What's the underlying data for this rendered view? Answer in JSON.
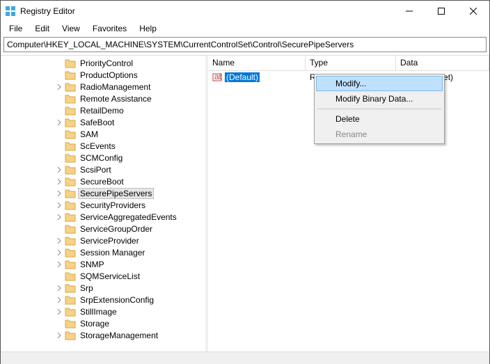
{
  "window": {
    "title": "Registry Editor"
  },
  "menubar": {
    "items": [
      "File",
      "Edit",
      "View",
      "Favorites",
      "Help"
    ]
  },
  "address": {
    "path": "Computer\\HKEY_LOCAL_MACHINE\\SYSTEM\\CurrentControlSet\\Control\\SecurePipeServers"
  },
  "tree": {
    "indent": 78,
    "selected": "SecurePipeServers",
    "items": [
      {
        "label": "PriorityControl",
        "expander": false
      },
      {
        "label": "ProductOptions",
        "expander": false
      },
      {
        "label": "RadioManagement",
        "expander": true
      },
      {
        "label": "Remote Assistance",
        "expander": false
      },
      {
        "label": "RetailDemo",
        "expander": false
      },
      {
        "label": "SafeBoot",
        "expander": true
      },
      {
        "label": "SAM",
        "expander": false
      },
      {
        "label": "ScEvents",
        "expander": false
      },
      {
        "label": "SCMConfig",
        "expander": false
      },
      {
        "label": "ScsiPort",
        "expander": true
      },
      {
        "label": "SecureBoot",
        "expander": true
      },
      {
        "label": "SecurePipeServers",
        "expander": true,
        "selected": true
      },
      {
        "label": "SecurityProviders",
        "expander": true
      },
      {
        "label": "ServiceAggregatedEvents",
        "expander": true
      },
      {
        "label": "ServiceGroupOrder",
        "expander": false
      },
      {
        "label": "ServiceProvider",
        "expander": true
      },
      {
        "label": "Session Manager",
        "expander": true
      },
      {
        "label": "SNMP",
        "expander": true
      },
      {
        "label": "SQMServiceList",
        "expander": false
      },
      {
        "label": "Srp",
        "expander": true
      },
      {
        "label": "SrpExtensionConfig",
        "expander": true
      },
      {
        "label": "StillImage",
        "expander": true
      },
      {
        "label": "Storage",
        "expander": false
      },
      {
        "label": "StorageManagement",
        "expander": true
      }
    ]
  },
  "list": {
    "columns": {
      "name": "Name",
      "type": "Type",
      "data": "Data"
    },
    "rows": [
      {
        "icon": "string-value-icon",
        "name": "(Default)",
        "type": "REG_SZ",
        "data": "(value not set)",
        "selected": true
      }
    ]
  },
  "context_menu": {
    "items": [
      {
        "label": "Modify...",
        "highlighted": true
      },
      {
        "label": "Modify Binary Data..."
      },
      {
        "sep": true
      },
      {
        "label": "Delete"
      },
      {
        "label": "Rename",
        "disabled": true
      }
    ]
  }
}
